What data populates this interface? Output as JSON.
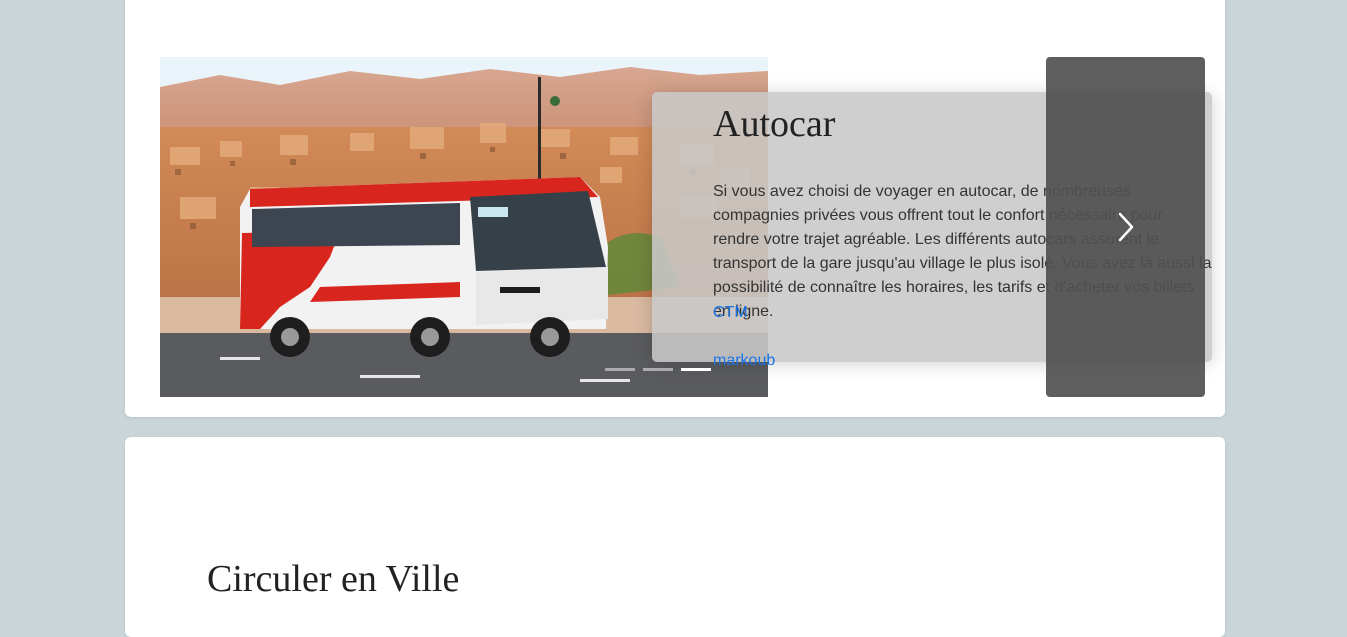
{
  "carousel": {
    "slide": {
      "image_alt": "Autocar rouge et blanc devant une ville du désert",
      "title": "Autocar",
      "text": "Si vous avez choisi de voyager en autocar, de nombreuses compagnies privées vous offrent tout le confort nécessaire pour rendre votre trajet agréable. Les différents autocars assurent le transport de la gare jusqu'au village le plus isolé. Vous avez là aussi la possibilité de connaître les horaires, les tarifs et d'acheter vos billets en ligne.",
      "links": [
        "CTM",
        "markoub"
      ]
    },
    "indicator_count": 3,
    "active_indicator": 2,
    "next_icon": "chevron-right-icon"
  },
  "section": {
    "title": "Circuler en Ville"
  },
  "colors": {
    "page_bg": "#c9d5d8",
    "card_bg": "#ffffff",
    "caption_bg": "#c8c8c8",
    "link": "#1a73e8",
    "control_bg": "#505050"
  }
}
